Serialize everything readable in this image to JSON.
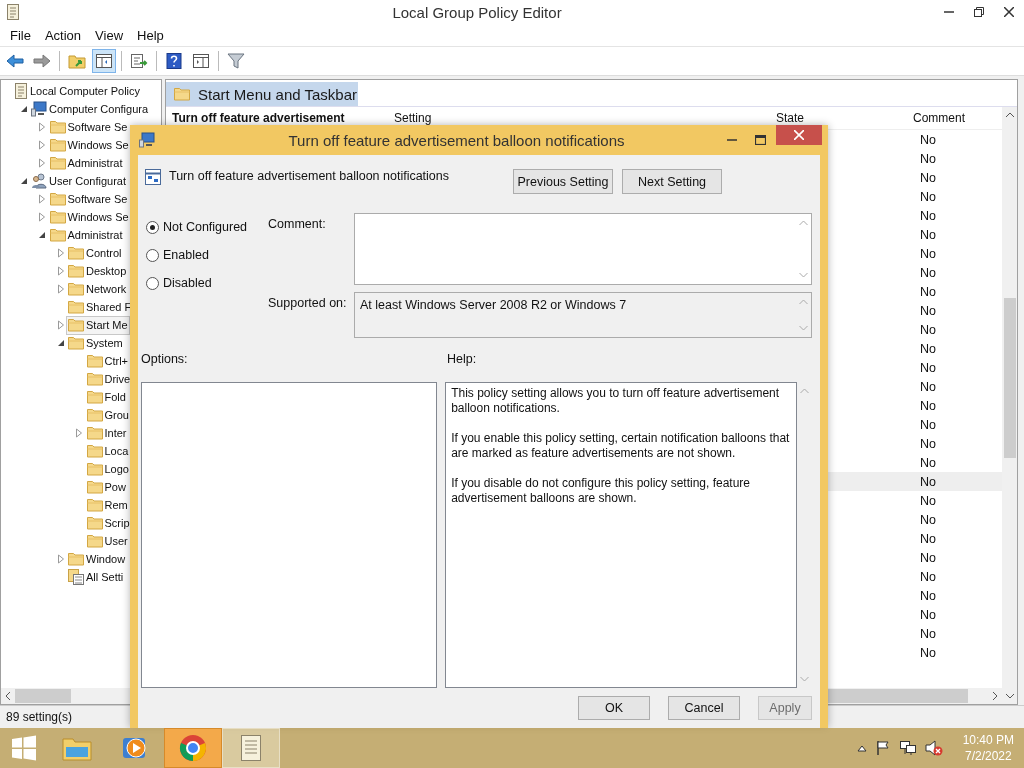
{
  "window": {
    "title": "Local Group Policy Editor"
  },
  "menu": [
    "File",
    "Action",
    "View",
    "Help"
  ],
  "toolbar": [
    [
      {
        "kind": "back",
        "pressed": false
      },
      {
        "kind": "forward",
        "pressed": false
      }
    ],
    [
      {
        "kind": "up",
        "pressed": false
      },
      {
        "kind": "tree",
        "pressed": true
      }
    ],
    [
      {
        "kind": "export",
        "pressed": false
      }
    ],
    [
      {
        "kind": "help",
        "pressed": false
      },
      {
        "kind": "panel",
        "pressed": false
      }
    ],
    [
      {
        "kind": "filter",
        "pressed": false
      }
    ]
  ],
  "tree": [
    {
      "label": "Local Computer Policy",
      "kind": "policy",
      "selected": false,
      "children": [
        {
          "label": "Computer Configura",
          "kind": "computer",
          "expanded": true,
          "selected": false,
          "children": [
            {
              "label": "Software Se",
              "kind": "folder",
              "expanded": false,
              "selected": false
            },
            {
              "label": "Windows Se",
              "kind": "folder",
              "expanded": false,
              "selected": false
            },
            {
              "label": "Administrat",
              "kind": "folder",
              "expanded": false,
              "selected": false
            }
          ]
        },
        {
          "label": "User Configurat",
          "kind": "user",
          "expanded": true,
          "selected": false,
          "children": [
            {
              "label": "Software Se",
              "kind": "folder",
              "expanded": false,
              "selected": false
            },
            {
              "label": "Windows Se",
              "kind": "folder",
              "expanded": false,
              "selected": false
            },
            {
              "label": "Administrat",
              "kind": "folder",
              "expanded": true,
              "selected": false,
              "children": [
                {
                  "label": "Control",
                  "kind": "folder",
                  "expanded": false,
                  "selected": false
                },
                {
                  "label": "Desktop",
                  "kind": "folder",
                  "expanded": false,
                  "selected": false
                },
                {
                  "label": "Network",
                  "kind": "folder",
                  "expanded": false,
                  "selected": false
                },
                {
                  "label": "Shared F",
                  "kind": "folder",
                  "selected": false
                },
                {
                  "label": "Start Me",
                  "kind": "folder",
                  "expanded": false,
                  "selected": true
                },
                {
                  "label": "System",
                  "kind": "folder",
                  "expanded": true,
                  "selected": false,
                  "children": [
                    {
                      "label": "Ctrl+",
                      "kind": "folder",
                      "selected": false
                    },
                    {
                      "label": "Drive",
                      "kind": "folder",
                      "selected": false
                    },
                    {
                      "label": "Fold",
                      "kind": "folder",
                      "selected": false
                    },
                    {
                      "label": "Grou",
                      "kind": "folder",
                      "selected": false
                    },
                    {
                      "label": "Inter",
                      "kind": "folder",
                      "expanded": false,
                      "selected": false
                    },
                    {
                      "label": "Loca",
                      "kind": "folder",
                      "selected": false
                    },
                    {
                      "label": "Logo",
                      "kind": "folder",
                      "selected": false
                    },
                    {
                      "label": "Pow",
                      "kind": "folder",
                      "selected": false
                    },
                    {
                      "label": "Rem",
                      "kind": "folder",
                      "selected": false
                    },
                    {
                      "label": "Scrip",
                      "kind": "folder",
                      "selected": false
                    },
                    {
                      "label": "User",
                      "kind": "folder",
                      "selected": false
                    }
                  ]
                },
                {
                  "label": "Window",
                  "kind": "folder",
                  "expanded": false,
                  "selected": false
                },
                {
                  "label": "All Setti",
                  "kind": "settings",
                  "selected": false
                }
              ]
            }
          ]
        }
      ]
    }
  ],
  "details": {
    "heading": "Start Menu and Taskbar",
    "setting_title": "Turn off feature advertisement",
    "columns": [
      "Setting",
      "State",
      "Comment"
    ],
    "rows": [
      {
        "comment": "No",
        "selected": false
      },
      {
        "comment": "No",
        "selected": false
      },
      {
        "comment": "No",
        "selected": false
      },
      {
        "comment": "No",
        "selected": false
      },
      {
        "comment": "No",
        "selected": false
      },
      {
        "comment": "No",
        "selected": false
      },
      {
        "comment": "No",
        "selected": false
      },
      {
        "comment": "No",
        "selected": false
      },
      {
        "comment": "No",
        "selected": false
      },
      {
        "comment": "No",
        "selected": false
      },
      {
        "comment": "No",
        "selected": false
      },
      {
        "comment": "No",
        "selected": false
      },
      {
        "comment": "No",
        "selected": false
      },
      {
        "comment": "No",
        "selected": false
      },
      {
        "comment": "No",
        "selected": false
      },
      {
        "comment": "No",
        "selected": false
      },
      {
        "comment": "No",
        "selected": false
      },
      {
        "comment": "No",
        "selected": false
      },
      {
        "comment": "No",
        "selected": true
      },
      {
        "comment": "No",
        "selected": false
      },
      {
        "comment": "No",
        "selected": false
      },
      {
        "comment": "No",
        "selected": false
      },
      {
        "comment": "No",
        "selected": false
      },
      {
        "comment": "No",
        "selected": false
      },
      {
        "comment": "No",
        "selected": false
      },
      {
        "comment": "No",
        "selected": false
      },
      {
        "comment": "No",
        "selected": false
      },
      {
        "comment": "No",
        "selected": false
      }
    ]
  },
  "status_bar": "89 setting(s)",
  "dialog": {
    "title": "Turn off feature advertisement balloon notifications",
    "setting_name": "Turn off feature advertisement balloon notifications",
    "nav_buttons": [
      "Previous Setting",
      "Next Setting"
    ],
    "states": [
      {
        "label": "Not Configured",
        "selected": true
      },
      {
        "label": "Enabled",
        "selected": false
      },
      {
        "label": "Disabled",
        "selected": false
      }
    ],
    "comment_label": "Comment:",
    "supported_label": "Supported on:",
    "supported_value": "At least Windows Server 2008 R2 or Windows 7",
    "options_label": "Options:",
    "help_label": "Help:",
    "help_text": [
      "This policy setting allows you to turn off feature advertisement balloon notifications.",
      "If you enable this policy setting, certain notification balloons that are marked as feature advertisements are not shown.",
      "If you disable do not configure this policy setting, feature advertisement balloons are shown."
    ],
    "buttons": [
      {
        "label": "OK",
        "disabled": false
      },
      {
        "label": "Cancel",
        "disabled": false
      },
      {
        "label": "Apply",
        "disabled": true
      }
    ]
  },
  "taskbar": {
    "apps": [
      {
        "kind": "explorer",
        "open": false,
        "flashing": false
      },
      {
        "kind": "media",
        "open": false,
        "flashing": false
      },
      {
        "kind": "chrome",
        "open": true,
        "flashing": true
      },
      {
        "kind": "policy",
        "open": true,
        "flashing": false
      }
    ],
    "time": "10:40 PM",
    "date": "7/2/2022"
  }
}
